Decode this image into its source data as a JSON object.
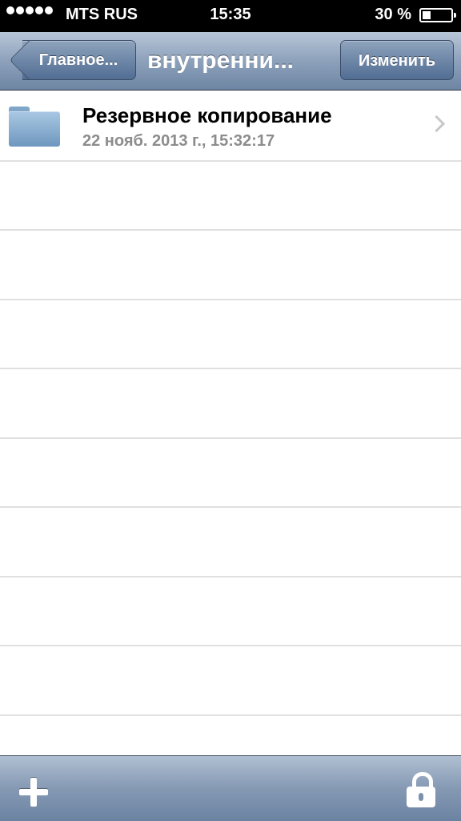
{
  "status_bar": {
    "carrier": "MTS RUS",
    "time": "15:35",
    "battery_percent": "30 %",
    "battery_level": 0.3,
    "signal_bars": 5
  },
  "nav": {
    "back_label": "Главное...",
    "title": "внутренни...",
    "edit_label": "Изменить"
  },
  "items": [
    {
      "title": "Резервное копирование",
      "subtitle": "22 нояб. 2013 г., 15:32:17",
      "icon": "folder-icon"
    }
  ],
  "toolbar": {
    "left_icon": "plus-icon",
    "right_icon": "lock-icon"
  },
  "colors": {
    "nav_bar": "#7f95b2",
    "date_text": "#8c8c8c"
  }
}
